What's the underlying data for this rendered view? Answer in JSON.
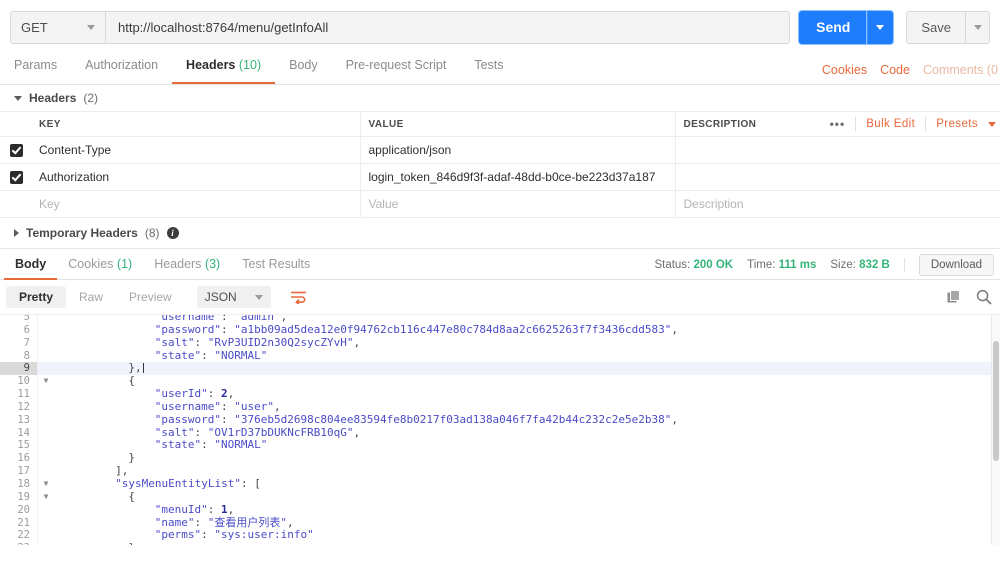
{
  "request": {
    "method": "GET",
    "url": "http://localhost:8764/menu/getInfoAll",
    "send_label": "Send",
    "save_label": "Save"
  },
  "request_tabs": [
    {
      "label": "Params",
      "count": "",
      "active": false
    },
    {
      "label": "Authorization",
      "count": "",
      "active": false
    },
    {
      "label": "Headers",
      "count": "(10)",
      "active": true
    },
    {
      "label": "Body",
      "count": "",
      "active": false
    },
    {
      "label": "Pre-request Script",
      "count": "",
      "active": false
    },
    {
      "label": "Tests",
      "count": "",
      "active": false
    }
  ],
  "request_tabs_right": {
    "cookies": "Cookies",
    "code": "Code",
    "comments": "Comments (0"
  },
  "headers_section": {
    "title": "Headers",
    "count": "(2)",
    "columns": {
      "key": "KEY",
      "value": "VALUE",
      "description": "DESCRIPTION"
    },
    "actions": {
      "dots": "•••",
      "bulk_edit": "Bulk Edit",
      "presets": "Presets"
    },
    "rows": [
      {
        "checked": true,
        "key": "Content-Type",
        "value": "application/json",
        "description": ""
      },
      {
        "checked": true,
        "key": "Authorization",
        "value": "login_token_846d9f3f-adaf-48dd-b0ce-be223d37a187",
        "description": ""
      }
    ],
    "placeholder_row": {
      "key": "Key",
      "value": "Value",
      "description": "Description"
    }
  },
  "temporary_headers": {
    "title": "Temporary Headers",
    "count": "(8)"
  },
  "response_tabs": [
    {
      "label": "Body",
      "count": "",
      "active": true
    },
    {
      "label": "Cookies",
      "count": "(1)",
      "active": false
    },
    {
      "label": "Headers",
      "count": "(3)",
      "active": false
    },
    {
      "label": "Test Results",
      "count": "",
      "active": false
    }
  ],
  "response_meta": {
    "status_label": "Status:",
    "status_value": "200 OK",
    "time_label": "Time:",
    "time_value": "111 ms",
    "size_label": "Size:",
    "size_value": "832 B",
    "download_label": "Download"
  },
  "body_toolbar": {
    "pretty": "Pretty",
    "raw": "Raw",
    "preview": "Preview",
    "format": "JSON"
  },
  "colors": {
    "accent_orange": "#e8693b",
    "send_blue": "#1d7dfc",
    "status_green": "#35b47a",
    "json_string": "#4b4bc8"
  },
  "code_lines": [
    {
      "num": "5",
      "fold": "",
      "indent": 8,
      "html": "<span class=\"k\">\"username\"</span><span class=\"p\">: </span><span class=\"s\">\"admin\"</span><span class=\"p\">,</span>",
      "highlight": false
    },
    {
      "num": "6",
      "fold": "",
      "indent": 8,
      "html": "<span class=\"k\">\"password\"</span><span class=\"p\">: </span><span class=\"s\">\"a1bb09ad5dea12e0f94762cb116c447e80c784d8aa2c6625263f7f3436cdd583\"</span><span class=\"p\">,</span>",
      "highlight": false
    },
    {
      "num": "7",
      "fold": "",
      "indent": 8,
      "html": "<span class=\"k\">\"salt\"</span><span class=\"p\">: </span><span class=\"s\">\"RvP3UID2n30Q2sycZYvH\"</span><span class=\"p\">,</span>",
      "highlight": false
    },
    {
      "num": "8",
      "fold": "",
      "indent": 8,
      "html": "<span class=\"k\">\"state\"</span><span class=\"p\">: </span><span class=\"s\">\"NORMAL\"</span>",
      "highlight": false
    },
    {
      "num": "9",
      "fold": "",
      "indent": 4,
      "html": "<span class=\"p\">},</span><span class=\"cursor\"></span>",
      "highlight": true
    },
    {
      "num": "10",
      "fold": "▼",
      "indent": 4,
      "html": "<span class=\"p\">{</span>",
      "highlight": false
    },
    {
      "num": "11",
      "fold": "",
      "indent": 8,
      "html": "<span class=\"k\">\"userId\"</span><span class=\"p\">: </span><span class=\"n\">2</span><span class=\"p\">,</span>",
      "highlight": false
    },
    {
      "num": "12",
      "fold": "",
      "indent": 8,
      "html": "<span class=\"k\">\"username\"</span><span class=\"p\">: </span><span class=\"s\">\"user\"</span><span class=\"p\">,</span>",
      "highlight": false
    },
    {
      "num": "13",
      "fold": "",
      "indent": 8,
      "html": "<span class=\"k\">\"password\"</span><span class=\"p\">: </span><span class=\"s\">\"376eb5d2698c804ee83594fe8b0217f03ad138a046f7fa42b44c232c2e5e2b38\"</span><span class=\"p\">,</span>",
      "highlight": false
    },
    {
      "num": "14",
      "fold": "",
      "indent": 8,
      "html": "<span class=\"k\">\"salt\"</span><span class=\"p\">: </span><span class=\"s\">\"OV1rD37bDUKNcFRB10qG\"</span><span class=\"p\">,</span>",
      "highlight": false
    },
    {
      "num": "15",
      "fold": "",
      "indent": 8,
      "html": "<span class=\"k\">\"state\"</span><span class=\"p\">: </span><span class=\"s\">\"NORMAL\"</span>",
      "highlight": false
    },
    {
      "num": "16",
      "fold": "",
      "indent": 4,
      "html": "<span class=\"p\">}</span>",
      "highlight": false
    },
    {
      "num": "17",
      "fold": "",
      "indent": 2,
      "html": "<span class=\"p\">],</span>",
      "highlight": false
    },
    {
      "num": "18",
      "fold": "▼",
      "indent": 2,
      "html": "<span class=\"k\">\"sysMenuEntityList\"</span><span class=\"p\">: [</span>",
      "highlight": false
    },
    {
      "num": "19",
      "fold": "▼",
      "indent": 4,
      "html": "<span class=\"p\">{</span>",
      "highlight": false
    },
    {
      "num": "20",
      "fold": "",
      "indent": 8,
      "html": "<span class=\"k\">\"menuId\"</span><span class=\"p\">: </span><span class=\"n\">1</span><span class=\"p\">,</span>",
      "highlight": false
    },
    {
      "num": "21",
      "fold": "",
      "indent": 8,
      "html": "<span class=\"k\">\"name\"</span><span class=\"p\">: </span><span class=\"s\">\"</span><span class=\"cjk\">查看用户列表</span><span class=\"s\">\"</span><span class=\"p\">,</span>",
      "highlight": false
    },
    {
      "num": "22",
      "fold": "",
      "indent": 8,
      "html": "<span class=\"k\">\"perms\"</span><span class=\"p\">: </span><span class=\"s\">\"sys:user:info\"</span>",
      "highlight": false
    },
    {
      "num": "23",
      "fold": "",
      "indent": 4,
      "html": "<span class=\"p\">},</span>",
      "highlight": false
    }
  ]
}
